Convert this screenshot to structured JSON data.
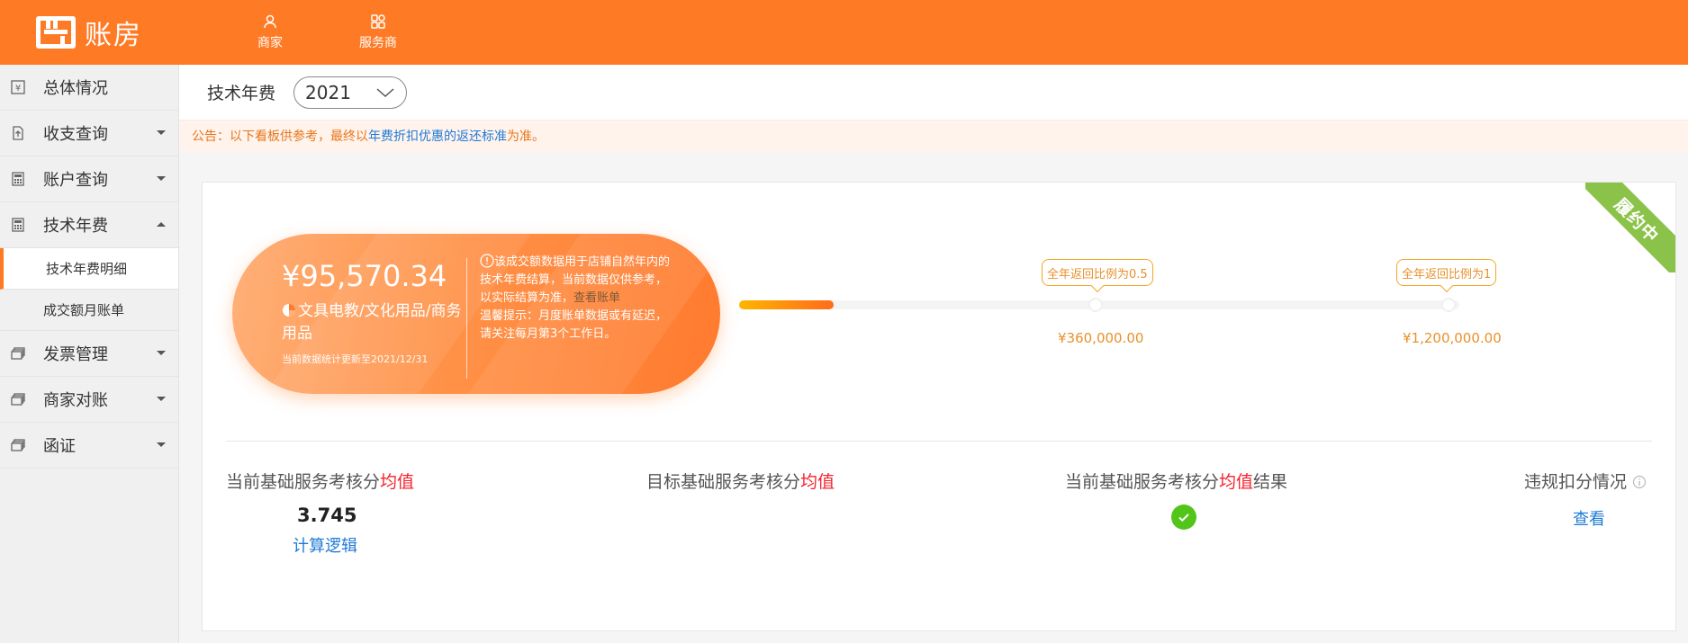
{
  "brand": {
    "name": "账房",
    "color": "#ff7a25"
  },
  "topnav": [
    {
      "label": "商家",
      "icon": "user-icon"
    },
    {
      "label": "服务商",
      "icon": "grid-icon"
    }
  ],
  "sidebar": {
    "items": [
      {
        "label": "总体情况",
        "icon": "yen-doc-icon"
      },
      {
        "label": "收支查询",
        "icon": "export-doc-icon"
      },
      {
        "label": "账户查询",
        "icon": "calculator-icon"
      },
      {
        "label": "技术年费",
        "icon": "calculator-icon"
      },
      {
        "label": "发票管理",
        "icon": "stack-icon"
      },
      {
        "label": "商家对账",
        "icon": "stack-icon"
      },
      {
        "label": "函证",
        "icon": "stack-icon"
      }
    ],
    "subitems": [
      {
        "label": "技术年费明细",
        "active": true
      },
      {
        "label": "成交额月账单",
        "active": false
      }
    ]
  },
  "header": {
    "title": "技术年费",
    "year": "2021"
  },
  "notice": {
    "prefix": "公告：以下看板供参考，最终以",
    "link": "年费折扣优惠的返还标准",
    "suffix": "为准。"
  },
  "card": {
    "ribbon": "履约中",
    "amount": "¥95,570.34",
    "category": "文具电教/文化用品/商务用品",
    "updated": "当前数据统计更新至2021/12/31",
    "desc1": "该成交额数据用于店铺自然年内的技术年费结算，当前数据仅供参考，以实际结算为准，",
    "desc_link": "查看账单",
    "desc2": "温馨提示：月度账单数据或有延迟，请关注每月第3个工作日。",
    "progress": {
      "current_value": 95570.34,
      "milestones": [
        {
          "tag": "全年返回比例为0.5",
          "value_label": "¥360,000.00"
        },
        {
          "tag": "全年返回比例为1",
          "value_label": "¥1,200,000.00"
        }
      ]
    },
    "metrics": {
      "m1_prefix": "当前基础服务考核分",
      "m1_red": "均值",
      "m1_value": "3.745",
      "m1_link": "计算逻辑",
      "m2_prefix": "目标基础服务考核分",
      "m2_red": "均值",
      "m3_prefix": "当前基础服务考核分",
      "m3_red": "均值",
      "m3_suffix": "结果",
      "m4_label": "违规扣分情况",
      "m4_link": "查看"
    }
  }
}
